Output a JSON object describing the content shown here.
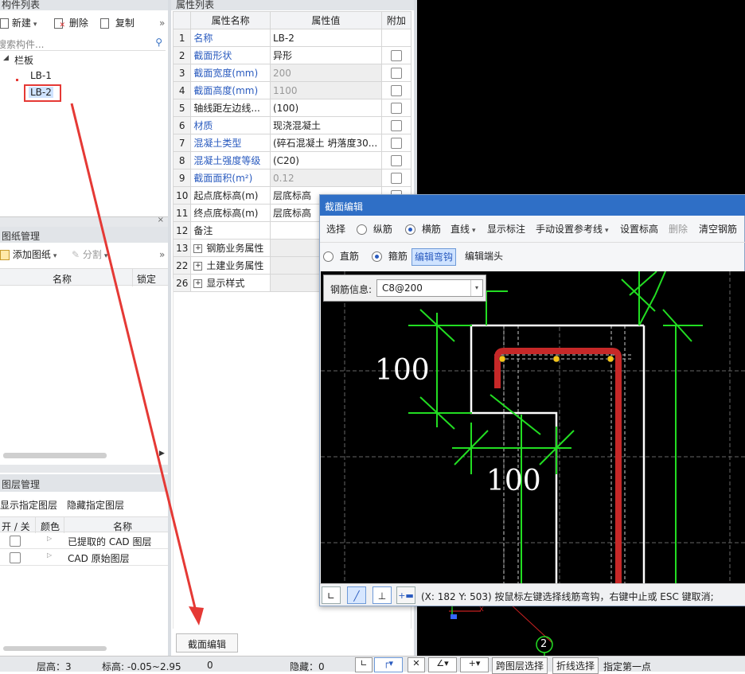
{
  "component_list": {
    "title": "构件列表",
    "toolbar": {
      "new": "新建",
      "delete": "删除",
      "copy": "复制"
    },
    "search_placeholder": "搜索构件...",
    "tree": {
      "group": "栏板",
      "items": [
        "LB-1",
        "LB-2"
      ],
      "selected": "LB-2"
    }
  },
  "drawing_mgmt": {
    "title": "图纸管理",
    "toolbar": {
      "add": "添加图纸",
      "split": "分割"
    },
    "columns": [
      "名称",
      "锁定"
    ]
  },
  "layer_mgmt": {
    "title": "图层管理",
    "show_specified": "显示指定图层",
    "hide_specified": "隐藏指定图层",
    "columns": [
      "开 / 关",
      "颜色",
      "名称"
    ],
    "rows": [
      "已提取的 CAD 图层",
      "CAD 原始图层"
    ]
  },
  "property_list": {
    "title": "属性列表",
    "columns": [
      "属性名称",
      "属性值",
      "附加"
    ],
    "rows": [
      {
        "n": "1",
        "name": "名称",
        "value": "LB-2",
        "blue": true,
        "check": false
      },
      {
        "n": "2",
        "name": "截面形状",
        "value": "异形",
        "blue": true,
        "check": true
      },
      {
        "n": "3",
        "name": "截面宽度(mm)",
        "value": "200",
        "blue": true,
        "check": true,
        "gray": true
      },
      {
        "n": "4",
        "name": "截面高度(mm)",
        "value": "1100",
        "blue": true,
        "check": true,
        "gray": true
      },
      {
        "n": "5",
        "name": "轴线距左边线...",
        "value": "(100)",
        "blue": false,
        "check": true
      },
      {
        "n": "6",
        "name": "材质",
        "value": "现浇混凝土",
        "blue": true,
        "check": true
      },
      {
        "n": "7",
        "name": "混凝土类型",
        "value": "(碎石混凝土 坍落度30...",
        "blue": true,
        "check": true
      },
      {
        "n": "8",
        "name": "混凝土强度等级",
        "value": "(C20)",
        "blue": true,
        "check": true
      },
      {
        "n": "9",
        "name": "截面面积(m²)",
        "value": "0.12",
        "blue": true,
        "check": true,
        "gray": true
      },
      {
        "n": "10",
        "name": "起点底标高(m)",
        "value": "层底标高",
        "blue": false,
        "check": true
      },
      {
        "n": "11",
        "name": "终点底标高(m)",
        "value": "层底标高",
        "blue": false,
        "check": false
      },
      {
        "n": "12",
        "name": "备注",
        "value": "",
        "blue": false,
        "check": false
      },
      {
        "n": "13",
        "name": "钢筋业务属性",
        "value": "",
        "blue": false,
        "check": false,
        "group": true
      },
      {
        "n": "22",
        "name": "土建业务属性",
        "value": "",
        "blue": false,
        "check": false,
        "group": true
      },
      {
        "n": "26",
        "name": "显示样式",
        "value": "",
        "blue": false,
        "check": false,
        "group": true
      }
    ],
    "section_edit_tab": "截面编辑"
  },
  "dialog": {
    "title": "截面编辑",
    "toolbar": [
      "选择",
      "纵筋",
      "横筋",
      "直线",
      "显示标注",
      "手动设置参考线",
      "设置标高",
      "删除",
      "清空钢筋"
    ],
    "row2": {
      "straight": "直筋",
      "stirrup": "箍筋",
      "edit_hook": "编辑弯钩",
      "edit_end": "编辑端头"
    },
    "rebar_info_label": "钢筋信息:",
    "rebar_info_value": "C8@200",
    "dim1": "100",
    "dim2": "100",
    "status": "(X: 182 Y: 503) 按鼠标左键选择线筋弯钩，右键中止或 ESC 键取消;"
  },
  "canvas": {
    "axis_label": "2"
  },
  "statusbar": {
    "floor_height": "层高：3",
    "elevation": "标高: -0.05~2.95",
    "zero": "0",
    "hidden": "隐藏：0",
    "cross_floor": "跨图层选择",
    "polyline": "折线选择",
    "specify_first": "指定第一点"
  },
  "colors": {
    "highlight": "#e53935",
    "rebar": "#c62828",
    "axis_green": "#22dd22"
  }
}
